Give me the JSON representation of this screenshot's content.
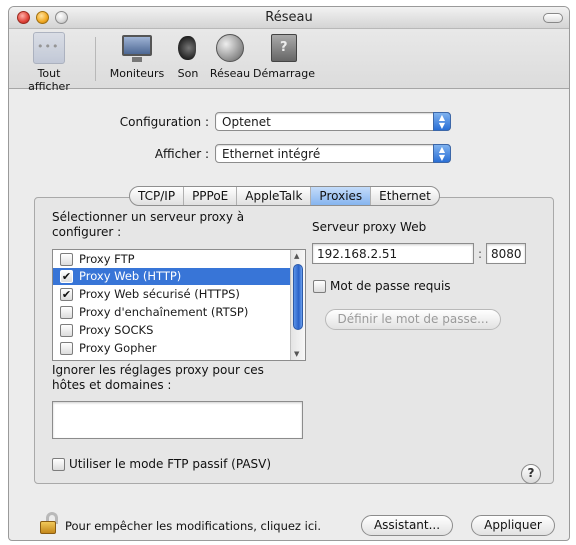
{
  "window": {
    "title": "Réseau"
  },
  "toolbar": {
    "items": [
      {
        "label": "Tout afficher",
        "icon": "grid-icon"
      },
      {
        "label": "Moniteurs",
        "icon": "monitor-icon"
      },
      {
        "label": "Son",
        "icon": "speaker-icon"
      },
      {
        "label": "Réseau",
        "icon": "network-globe-icon"
      },
      {
        "label": "Démarrage",
        "icon": "startup-disk-icon"
      }
    ]
  },
  "form": {
    "configuration_label": "Configuration :",
    "configuration_value": "Optenet",
    "afficher_label": "Afficher :",
    "afficher_value": "Ethernet intégré"
  },
  "tabs": [
    "TCP/IP",
    "PPPoE",
    "AppleTalk",
    "Proxies",
    "Ethernet"
  ],
  "active_tab": "Proxies",
  "proxies": {
    "select_label": "Sélectionner un serveur proxy à configurer :",
    "list": [
      {
        "label": "Proxy FTP",
        "checked": false,
        "mark": ""
      },
      {
        "label": "Proxy Web (HTTP)",
        "checked": true,
        "mark": "✔"
      },
      {
        "label": "Proxy Web sécurisé (HTTPS)",
        "checked": true,
        "mark": "✔"
      },
      {
        "label": "Proxy d'enchaînement (RTSP)",
        "checked": false,
        "mark": ""
      },
      {
        "label": "Proxy SOCKS",
        "checked": false,
        "mark": ""
      },
      {
        "label": "Proxy Gopher",
        "checked": false,
        "mark": ""
      }
    ],
    "server_label": "Serveur proxy Web",
    "server_value": "192.168.2.51",
    "port_separator": ":",
    "port_value": "8080",
    "password_checkbox": "Mot de passe requis",
    "set_password_button": "Définir le mot de passe...",
    "bypass_label": "Ignorer les réglages proxy pour ces hôtes et domaines :",
    "bypass_value": "",
    "passive_ftp_checkbox": "Utiliser le mode FTP passif (PASV)",
    "help_button": "?"
  },
  "footer": {
    "lock_text": "Pour empêcher les modifications, cliquez ici.",
    "assistant_button": "Assistant...",
    "apply_button": "Appliquer"
  }
}
